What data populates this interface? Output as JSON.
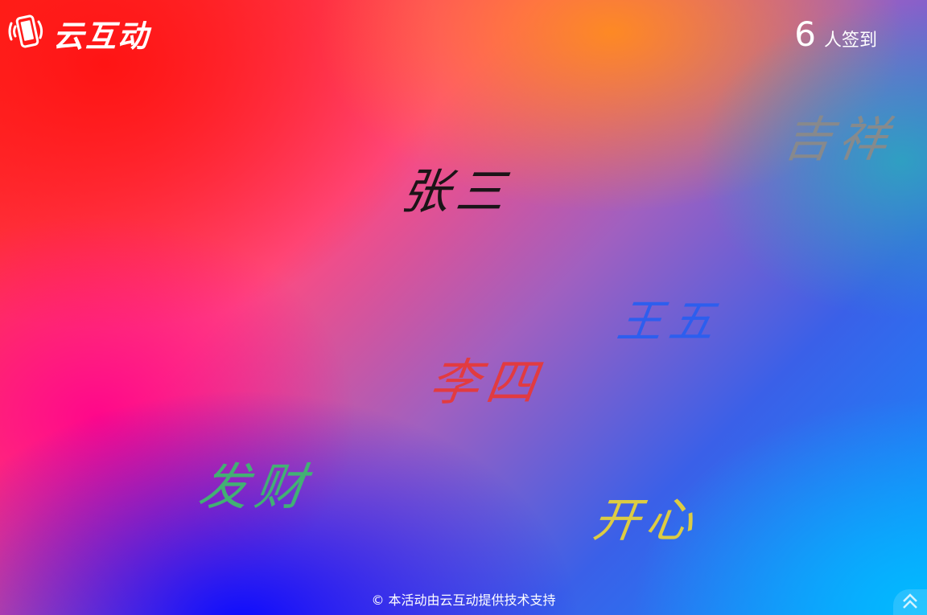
{
  "app": {
    "logo_text": "云互动"
  },
  "header": {
    "count": "6",
    "count_label": "人签到"
  },
  "signatures": [
    {
      "id": "zhangsan",
      "text": "张三",
      "color": "#111111"
    },
    {
      "id": "jixiang",
      "text": "吉祥",
      "color": "#8a8a8a"
    },
    {
      "id": "wangwu",
      "text": "王五",
      "color": "#2a5ef0"
    },
    {
      "id": "lisi",
      "text": "李四",
      "color": "#e63a3a"
    },
    {
      "id": "facai",
      "text": "发财",
      "color": "#3fb870"
    },
    {
      "id": "kaixin",
      "text": "开心",
      "color": "#e6d23a"
    }
  ],
  "footer": {
    "text": "© 本活动由云互动提供技术支持"
  },
  "icons": {
    "logo": "phone-icon",
    "scroll_top": "chevron-up-icon"
  }
}
